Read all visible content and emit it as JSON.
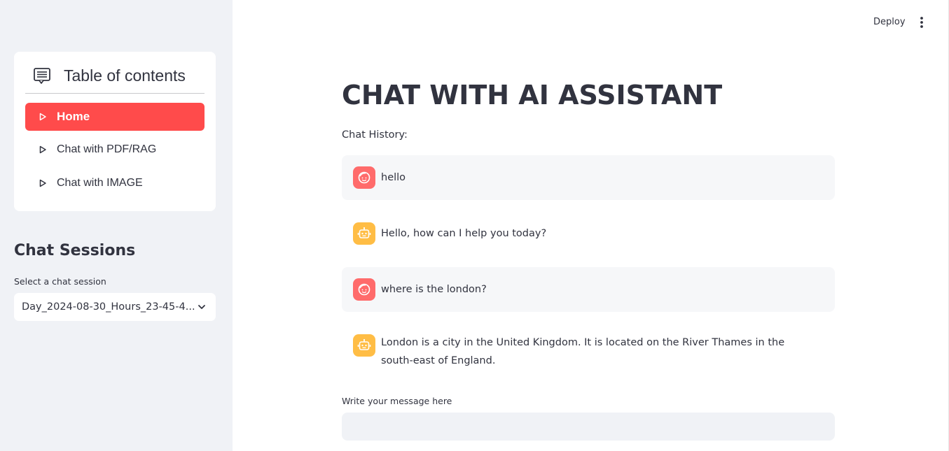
{
  "sidebar": {
    "toc_title": "Table of contents",
    "nav": [
      {
        "label": "Home",
        "active": true
      },
      {
        "label": "Chat with PDF/RAG",
        "active": false
      },
      {
        "label": "Chat with IMAGE",
        "active": false
      }
    ],
    "sessions_title": "Chat Sessions",
    "session_select_label": "Select a chat session",
    "session_selected": "Day_2024-08-30_Hours_23-45-4..."
  },
  "topbar": {
    "deploy_label": "Deploy",
    "menu_icon": "vertical-dots-icon"
  },
  "main": {
    "title": "CHAT WITH AI ASSISTANT",
    "history_label": "Chat History:",
    "messages": [
      {
        "role": "user",
        "text": "hello",
        "icon": "user-face-icon"
      },
      {
        "role": "assistant",
        "text": "Hello, how can I help you today?",
        "icon": "robot-icon"
      },
      {
        "role": "user",
        "text": "where is the london?",
        "icon": "user-face-icon"
      },
      {
        "role": "assistant",
        "text": "London is a city in the United Kingdom. It is located on the River Thames in the south-east of England.",
        "icon": "robot-icon"
      }
    ],
    "input_label": "Write your message here",
    "input_value": "",
    "input_placeholder": ""
  },
  "colors": {
    "accent": "#ff4b4b",
    "user_avatar": "#ff6b6b",
    "bot_avatar": "#ffbd45",
    "sidebar_bg": "#f0f2f6"
  }
}
